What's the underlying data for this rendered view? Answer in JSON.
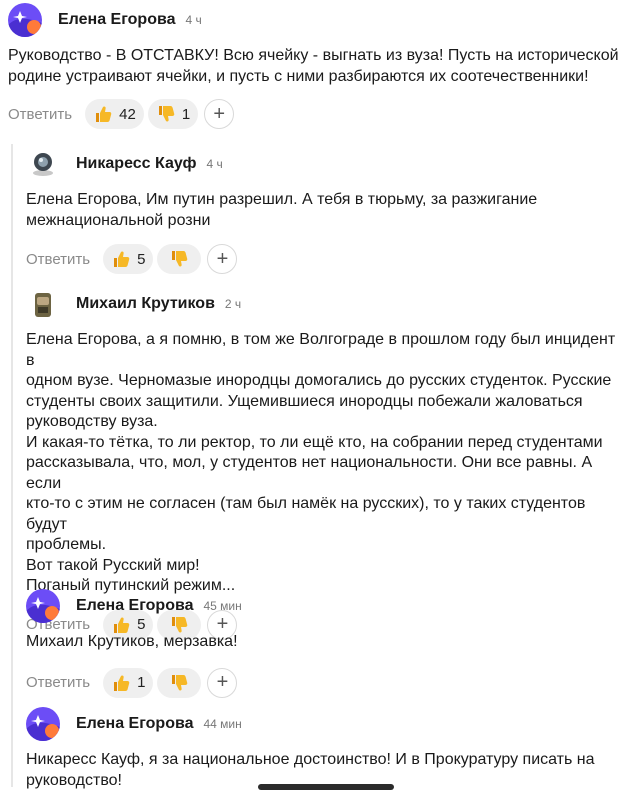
{
  "comments": [
    {
      "author": "Елена Егорова",
      "time": "4 ч",
      "text": "Руководство - В ОТСТАВКУ! Всю ячейку - выгнать из вуза! Пусть на исторической\nродине устраивают ячейки, и пусть с ними разбираются их соотечественники!",
      "reply": "Ответить",
      "likes": "42",
      "dislikes": "1"
    },
    {
      "author": "Никаресс Кауф",
      "time": "4 ч",
      "text": "Елена Егорова, Им путин разрешил. А тебя в тюрьму, за разжигание\nмежнациональной розни",
      "reply": "Ответить",
      "likes": "5",
      "dislikes": ""
    },
    {
      "author": "Михаил Крутиков",
      "time": "2 ч",
      "text": "Елена Егорова, а я помню, в том же Волгограде в прошлом году был инцидент в\nодном вузе. Черномазые инородцы домогались до русских студенток. Русские\nстуденты своих защитили. Ущемившиеся инородцы побежали жаловаться\nруководству вуза.\nИ какая-то тётка, то ли ректор, то ли ещё кто, на собрании перед студентами\nрассказывала, что, мол, у студентов нет национальности. Они все равны. А если\nкто-то с этим не согласен (там был намёк на русских), то у таких студентов будут\nпроблемы.\nВот такой Русский мир!\nПоганый путинский режим...",
      "reply": "Ответить",
      "likes": "5",
      "dislikes": ""
    },
    {
      "author": "Елена Егорова",
      "time": "45 мин",
      "text": "Михаил Крутиков, мерзавка!",
      "reply": "Ответить",
      "likes": "1",
      "dislikes": ""
    },
    {
      "author": "Елена Егорова",
      "time": "44 мин",
      "text": "Никаресс Кауф, я за национальное достоинство! И в Прокуратуру писать на\nруководство!",
      "reply": "",
      "likes": "",
      "dislikes": ""
    }
  ],
  "icons": {
    "like": "thumbs-up-icon",
    "dislike": "thumbs-down-icon",
    "add_reaction": "plus-icon"
  },
  "colors": {
    "avatar_purple": "#6c4df6",
    "avatar_orange": "#ff7a3a",
    "thumb_yellow": "#f6b826",
    "muted_text": "#8a8a8a"
  }
}
